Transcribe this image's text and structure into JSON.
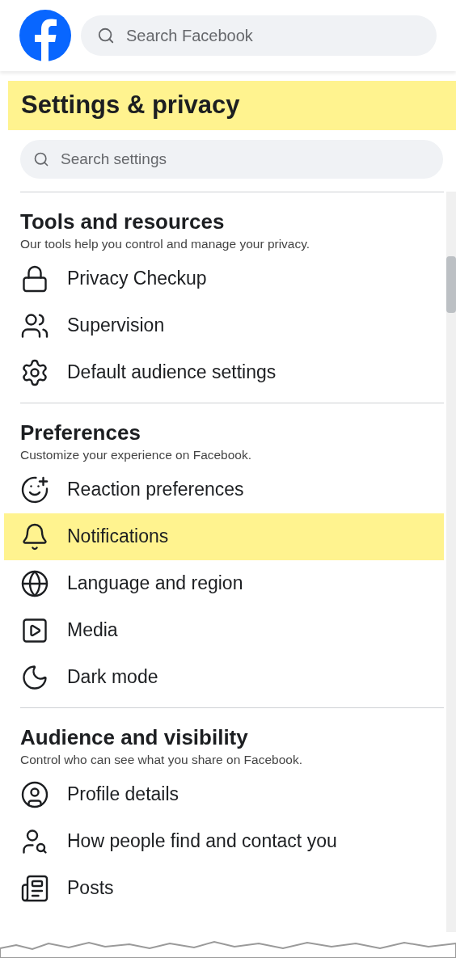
{
  "header": {
    "search": {
      "placeholder": "Search Facebook"
    }
  },
  "title": {
    "text": "Settings & privacy",
    "highlighted": true
  },
  "settings_search": {
    "placeholder": "Search settings"
  },
  "sections": [
    {
      "heading": "Tools and resources",
      "subtitle": "Our tools help you control and manage your privacy.",
      "items": [
        {
          "kind": "lock",
          "label": "Privacy Checkup",
          "highlighted": false
        },
        {
          "kind": "people",
          "label": "Supervision",
          "highlighted": false
        },
        {
          "kind": "gear",
          "label": "Default audience settings",
          "highlighted": false
        }
      ]
    },
    {
      "heading": "Preferences",
      "subtitle": "Customize your experience on Facebook.",
      "items": [
        {
          "kind": "reaction",
          "label": "Reaction preferences",
          "highlighted": false
        },
        {
          "kind": "bell",
          "label": "Notifications",
          "highlighted": true
        },
        {
          "kind": "globe",
          "label": "Language and region",
          "highlighted": false
        },
        {
          "kind": "media",
          "label": "Media",
          "highlighted": false
        },
        {
          "kind": "moon",
          "label": "Dark mode",
          "highlighted": false
        }
      ]
    },
    {
      "heading": "Audience and visibility",
      "subtitle": "Control who can see what you share on Facebook.",
      "items": [
        {
          "kind": "profile",
          "label": "Profile details",
          "highlighted": false
        },
        {
          "kind": "find",
          "label": "How people find and contact you",
          "highlighted": false
        },
        {
          "kind": "posts",
          "label": "Posts",
          "highlighted": false
        }
      ]
    }
  ]
}
